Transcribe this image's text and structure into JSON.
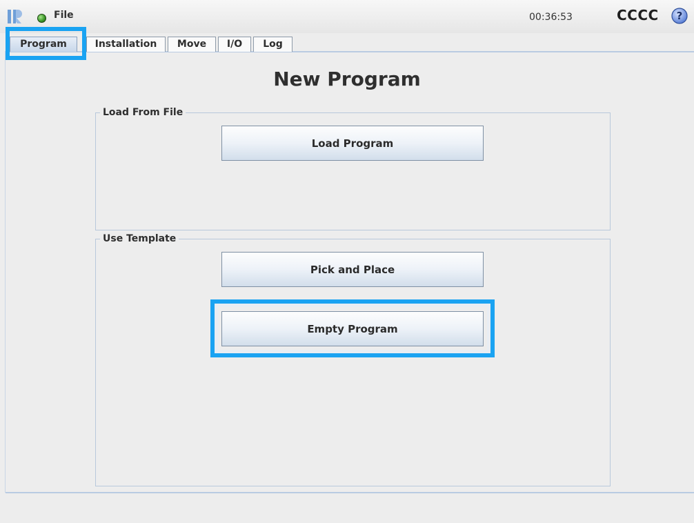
{
  "header": {
    "file_label": "File",
    "clock": "00:36:53",
    "robot_name": "CCCC",
    "help_symbol": "?",
    "status_color": "#3f9a2c",
    "icons": [
      "ur-logo-icon",
      "status-dot-icon",
      "help-icon"
    ]
  },
  "tabs": [
    {
      "label": "Program",
      "active": true
    },
    {
      "label": "Installation",
      "active": false
    },
    {
      "label": "Move",
      "active": false
    },
    {
      "label": "I/O",
      "active": false
    },
    {
      "label": "Log",
      "active": false
    }
  ],
  "main": {
    "title": "New Program",
    "load_group": {
      "label": "Load From File",
      "load_button": "Load Program"
    },
    "template_group": {
      "label": "Use Template",
      "pick_button": "Pick and Place",
      "empty_button": "Empty Program"
    }
  },
  "colors": {
    "highlight": "#1aa3f2",
    "accent": "#b9cbe2"
  }
}
